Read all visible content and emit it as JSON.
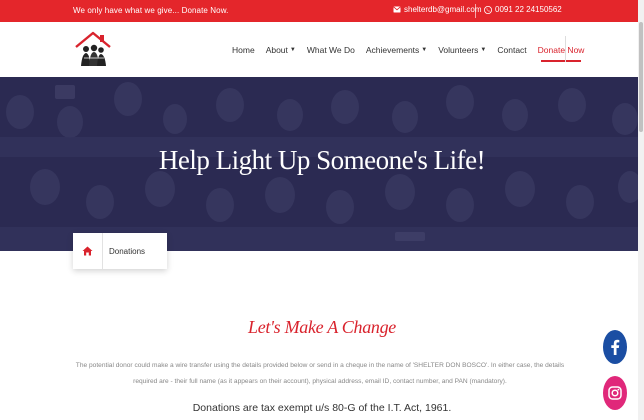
{
  "topbar": {
    "tagline": "We only have what we give... Donate Now.",
    "email": "shelterdb@gmail.com",
    "phone": "0091 22 24150562",
    "email_icon": "envelope-icon",
    "phone_icon": "phone-icon",
    "color": "#e4262b"
  },
  "nav": {
    "items": [
      {
        "label": "Home",
        "dropdown": false
      },
      {
        "label": "About",
        "dropdown": true
      },
      {
        "label": "What We Do",
        "dropdown": false
      },
      {
        "label": "Achievements",
        "dropdown": true
      },
      {
        "label": "Volunteers",
        "dropdown": true
      },
      {
        "label": "Contact",
        "dropdown": false
      },
      {
        "label": "Donate Now",
        "dropdown": false,
        "active": true
      }
    ]
  },
  "hero": {
    "title": "Help Light Up Someone's Life!"
  },
  "breadcrumb": {
    "home_icon": "home-icon",
    "label": "Donations"
  },
  "content": {
    "heading": "Let's Make A Change",
    "paragraph": "The potential donor could make a wire transfer using the details provided below or send in a cheque in the name of 'SHELTER DON BOSCO'. In either case, the details required are - their full name (as it appears on their account), physical address, email ID, contact number, and PAN (mandatory).",
    "tax_note": "Donations are tax exempt u/s 80-G of the I.T. Act, 1961."
  },
  "social": {
    "facebook_icon": "facebook-icon",
    "instagram_icon": "instagram-icon",
    "facebook_color": "#1b4ea3",
    "instagram_color": "#e0287a"
  },
  "colors": {
    "accent": "#d9232d",
    "hero_overlay": "#2a2950"
  }
}
